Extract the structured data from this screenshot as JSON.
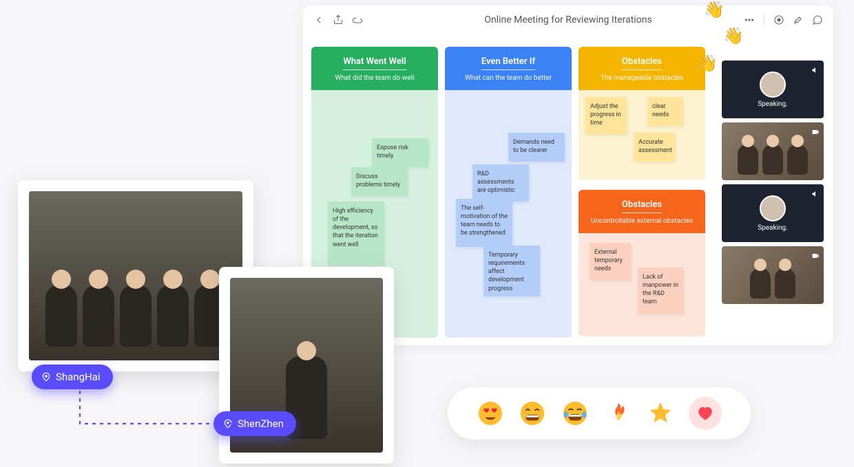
{
  "whiteboard": {
    "title": "Online Meeting for Reviewing Iterations"
  },
  "columns": {
    "well": {
      "title": "What Went Well",
      "subtitle": "What did the team do well",
      "notes": [
        {
          "text": "Expose risk timely"
        },
        {
          "text": "Discuss problems timely"
        },
        {
          "text": "High efficiency of the development, so that the iteration went well"
        }
      ]
    },
    "better": {
      "title": "Even Better If",
      "subtitle": "What can the team do better",
      "notes": [
        {
          "text": "Demands need to be clearer"
        },
        {
          "text": "R&D assessments are optimistic"
        },
        {
          "text": "The self-motivation of the team needs to be strengthened"
        },
        {
          "text": "Temporary requirements affect development progress"
        }
      ]
    },
    "obstacles_a": {
      "title": "Obstacles",
      "subtitle": "The manageable obstacles",
      "notes": [
        {
          "text": "Adjust the progress in time"
        },
        {
          "text": "clear needs"
        },
        {
          "text": "Accurate assessment"
        }
      ]
    },
    "obstacles_b": {
      "title": "Obstacles",
      "subtitle": "Uncontrollable external obstacles",
      "notes": [
        {
          "text": "External temporary needs"
        },
        {
          "text": "Lack of manpower in the R&D team"
        }
      ]
    }
  },
  "video": {
    "speaking_label": "Speaking."
  },
  "locations": {
    "a": "ShangHai",
    "b": "ShenZhen"
  },
  "reactions": {
    "items": [
      "heart-eyes",
      "grin",
      "joy",
      "fire",
      "star",
      "heart"
    ]
  }
}
